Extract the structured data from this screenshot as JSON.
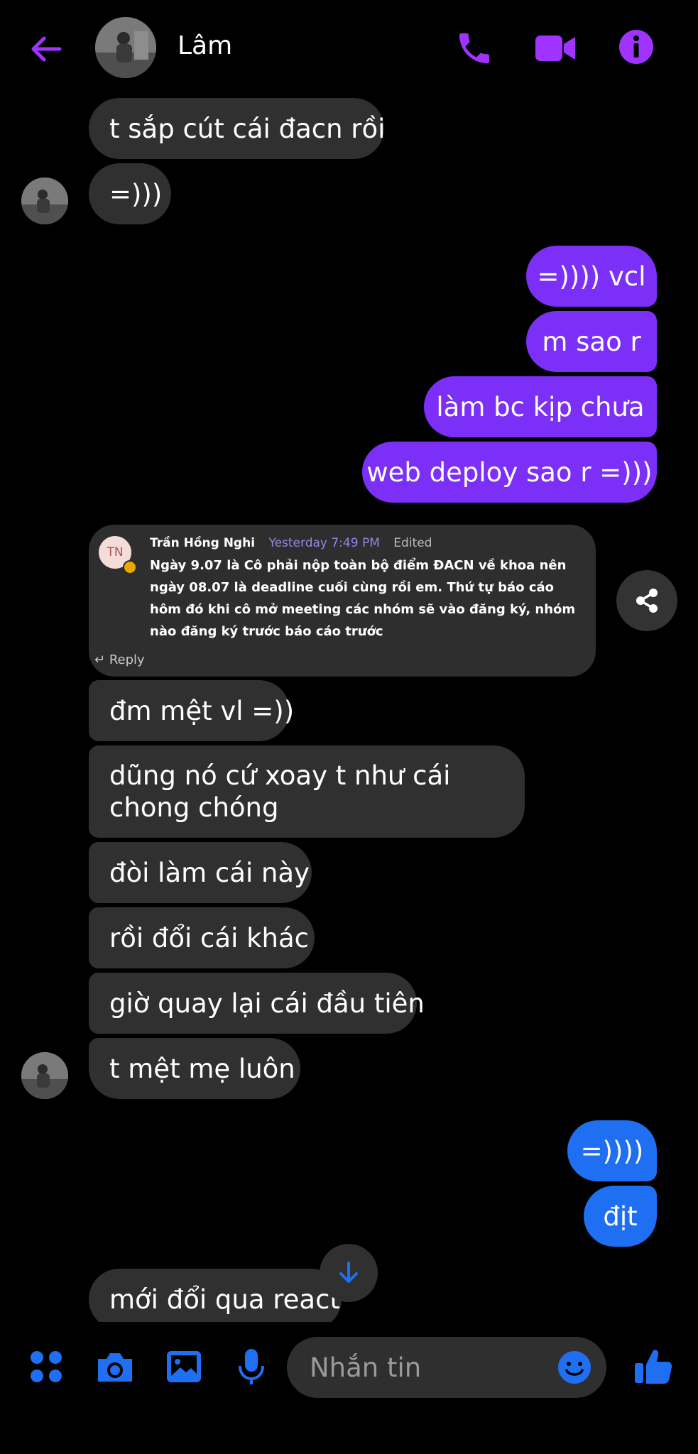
{
  "header": {
    "contact_name": "Lâm",
    "icons": [
      "back-arrow-icon",
      "phone-icon",
      "video-camera-icon",
      "info-icon"
    ]
  },
  "colors": {
    "accent_purple": "#a033ff",
    "accent_blue": "#1e6ff1",
    "bubble_incoming": "#303030",
    "bubble_outgoing_purple": "#7b2ff7"
  },
  "messages": {
    "m1": "t sắp cút cái đacn rồi",
    "m2": "=)))",
    "m3": "=)))) vcl",
    "m4": "m sao r",
    "m5": "làm bc kịp chưa",
    "m6": "web deploy sao r =)))",
    "m7": "đm mệt vl =))",
    "m8": "dũng nó cứ xoay t như cái chong chóng",
    "m9": "đòi làm cái này",
    "m10": "rồi đổi cái khác",
    "m11": "giờ quay lại cái đầu tiên",
    "m12": "t mệt mẹ luôn",
    "m13": "=))))",
    "m14": "địt",
    "m15": "mới đổi qua react"
  },
  "shared_message": {
    "avatar_initials": "TN",
    "author": "Trần Hồng Nghi",
    "time": "Yesterday 7:49 PM",
    "status": "Edited",
    "text": "Ngày 9.07 là Cô phải nộp toàn bộ điểm ĐACN về khoa nên ngày 08.07 là deadline cuối cùng rồi em. Thứ tự báo cáo hôm đó khi cô mở meeting các nhóm sẽ vào đăng ký, nhóm nào đăng ký trước báo cáo trước",
    "reply_label": "Reply"
  },
  "composer": {
    "placeholder": "Nhắn tin",
    "icons": [
      "apps-icon",
      "camera-icon",
      "image-icon",
      "microphone-icon",
      "emoji-icon",
      "thumbs-up-icon"
    ]
  }
}
